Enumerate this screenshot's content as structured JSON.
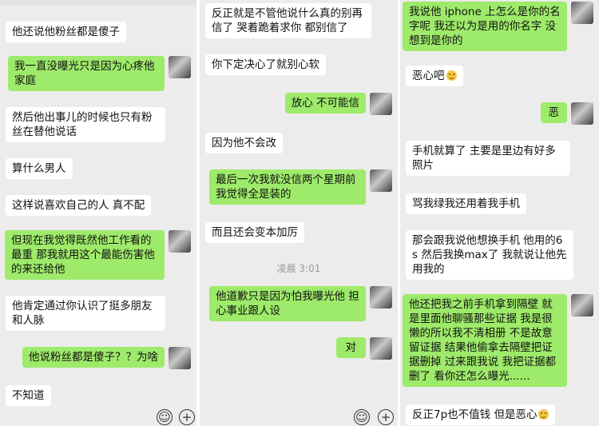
{
  "panel1": {
    "messages": [
      {
        "text": "他还说他粉丝都是傻子"
      },
      {
        "text": "我一直没曝光只是因为心疼他家庭"
      },
      {
        "text": "然后他出事儿的时候也只有粉丝在替他说话"
      },
      {
        "text": "算什么男人"
      },
      {
        "text": "这样说喜欢自己的人 真不配"
      },
      {
        "text": "但现在我觉得既然他工作看的最重 那我就用这个最能伤害他的来还给他"
      },
      {
        "text": "他肯定通过你认识了挺多朋友和人脉"
      },
      {
        "text": "他说粉丝都是傻子？？为啥"
      },
      {
        "text": "不知道"
      }
    ]
  },
  "panel2": {
    "messages": [
      {
        "text": "反正就是不管他说什么真的别再信了 哭着跪着求你 都别信了"
      },
      {
        "text": "你下定决心了就别心软"
      },
      {
        "text": "放心 不可能信"
      },
      {
        "text": "因为他不会改"
      },
      {
        "text": "最后一次我就没信两个星期前我觉得全是装的"
      },
      {
        "text": "而且还会变本加厉"
      },
      {
        "text": "他道歉只是因为怕我曝光他 担心事业跟人设"
      },
      {
        "text": "对"
      }
    ],
    "timestamp": "凌晨 3:01"
  },
  "panel3": {
    "messages": [
      {
        "text": "我说他 iphone 上怎么是你的名字呢 我还以为是用的你名字 没想到是你的"
      },
      {
        "text": "恶心吧"
      },
      {
        "text": "恶"
      },
      {
        "text": "手机就算了 主要是里边有好多照片"
      },
      {
        "text": "骂我绿我还用着我手机"
      },
      {
        "text": "那会跟我说他想换手机 他用的6s 然后我换max了 我就说让他先用我的"
      },
      {
        "text": "他还把我之前手机拿到隔壁 就是里面他聊骚那些证据 我是很懒的所以我不清相册 不是故意留证据 结果他偷拿去隔壁把证据删掉 过来跟我说 我把证据都删了 看你还怎么曝光......"
      },
      {
        "text": "反正7p也不值钱 但是恶心"
      }
    ]
  },
  "icons": {
    "emoji": "smiley-face-icon",
    "plus": "plus-circle-icon",
    "avatar": "user-avatar"
  },
  "colors": {
    "sent_bubble": "#9eea6a",
    "received_bubble": "#ffffff",
    "background": "#ececec"
  }
}
